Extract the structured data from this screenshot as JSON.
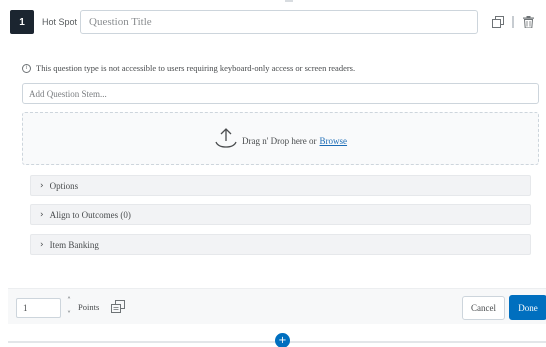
{
  "question": {
    "number": "1",
    "type_label": "Hot Spot",
    "title_placeholder": "Question Title",
    "title_value": ""
  },
  "header_icons": [
    "copy-icon",
    "drag-handle-icon",
    "trash-icon"
  ],
  "notice": {
    "icon": "info-icon",
    "text": "This question type is not accessible to users requiring keyboard-only access or screen readers."
  },
  "stem": {
    "placeholder": "Add Question Stem...",
    "value": ""
  },
  "dropzone": {
    "icon": "upload-icon",
    "text": "Drag n' Drop here or",
    "link": "Browse"
  },
  "sections": [
    {
      "label": "Options"
    },
    {
      "label": "Align to Outcomes (0)"
    },
    {
      "label": "Item Banking"
    }
  ],
  "footer": {
    "points_value": "1",
    "points_label": "Points",
    "cancel_label": "Cancel",
    "done_label": "Done"
  },
  "add_button_symbol": "+",
  "colors": {
    "primary": "#006fbf",
    "qnum_bg": "#1b2530",
    "section_bg": "#f2f3f5"
  }
}
